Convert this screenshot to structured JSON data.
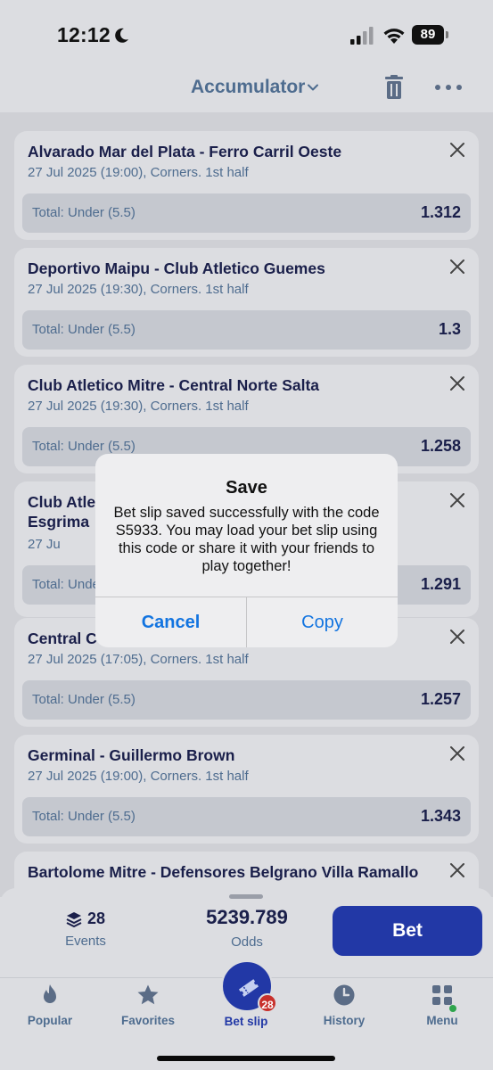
{
  "status_bar": {
    "time": "12:12",
    "battery": "89"
  },
  "header": {
    "title": "Accumulator"
  },
  "bets": [
    {
      "match": "Alvarado Mar del Plata - Ferro Carril Oeste",
      "details": "27 Jul 2025 (19:00), Corners. 1st half",
      "market": "Total: Under (5.5)",
      "odds": "1.312"
    },
    {
      "match": "Deportivo Maipu - Club Atletico Guemes",
      "details": "27 Jul 2025 (19:30), Corners. 1st half",
      "market": "Total: Under (5.5)",
      "odds": "1.3"
    },
    {
      "match": "Club Atletico Mitre - Central Norte Salta",
      "details": "27 Jul 2025 (19:30), Corners. 1st half",
      "market": "Total: Under (5.5)",
      "odds": "1.258"
    },
    {
      "match": "Club Atle Esgrima",
      "details": "27 Ju",
      "market": "Total: Unde",
      "odds": "1.291"
    },
    {
      "match": "Central C",
      "details": "27 Jul 2025 (17:05), Corners. 1st half",
      "market": "Total: Under (5.5)",
      "odds": "1.257"
    },
    {
      "match": "Germinal - Guillermo Brown",
      "details": "27 Jul 2025 (19:00), Corners. 1st half",
      "market": "Total: Under (5.5)",
      "odds": "1.343"
    },
    {
      "match": "Bartolome Mitre - Defensores Belgrano Villa Ramallo",
      "details": "",
      "market": "",
      "odds": ""
    }
  ],
  "summary": {
    "events_count": "28",
    "events_label": "Events",
    "odds_value": "5239.789",
    "odds_label": "Odds",
    "bet_label": "Bet"
  },
  "tabs": {
    "popular": "Popular",
    "favorites": "Favorites",
    "betslip": "Bet slip",
    "betslip_badge": "28",
    "history": "History",
    "menu": "Menu"
  },
  "alert": {
    "title": "Save",
    "message": "Bet slip saved successfully with the code S5933. You may load your bet slip using this code or share it with your friends to play together!",
    "cancel": "Cancel",
    "copy": "Copy"
  },
  "colors": {
    "accent": "#2238a6",
    "text_dark": "#1a1f4a",
    "text_muted": "#4e6c8f",
    "badge": "#c8302b",
    "link": "#1274e0"
  }
}
